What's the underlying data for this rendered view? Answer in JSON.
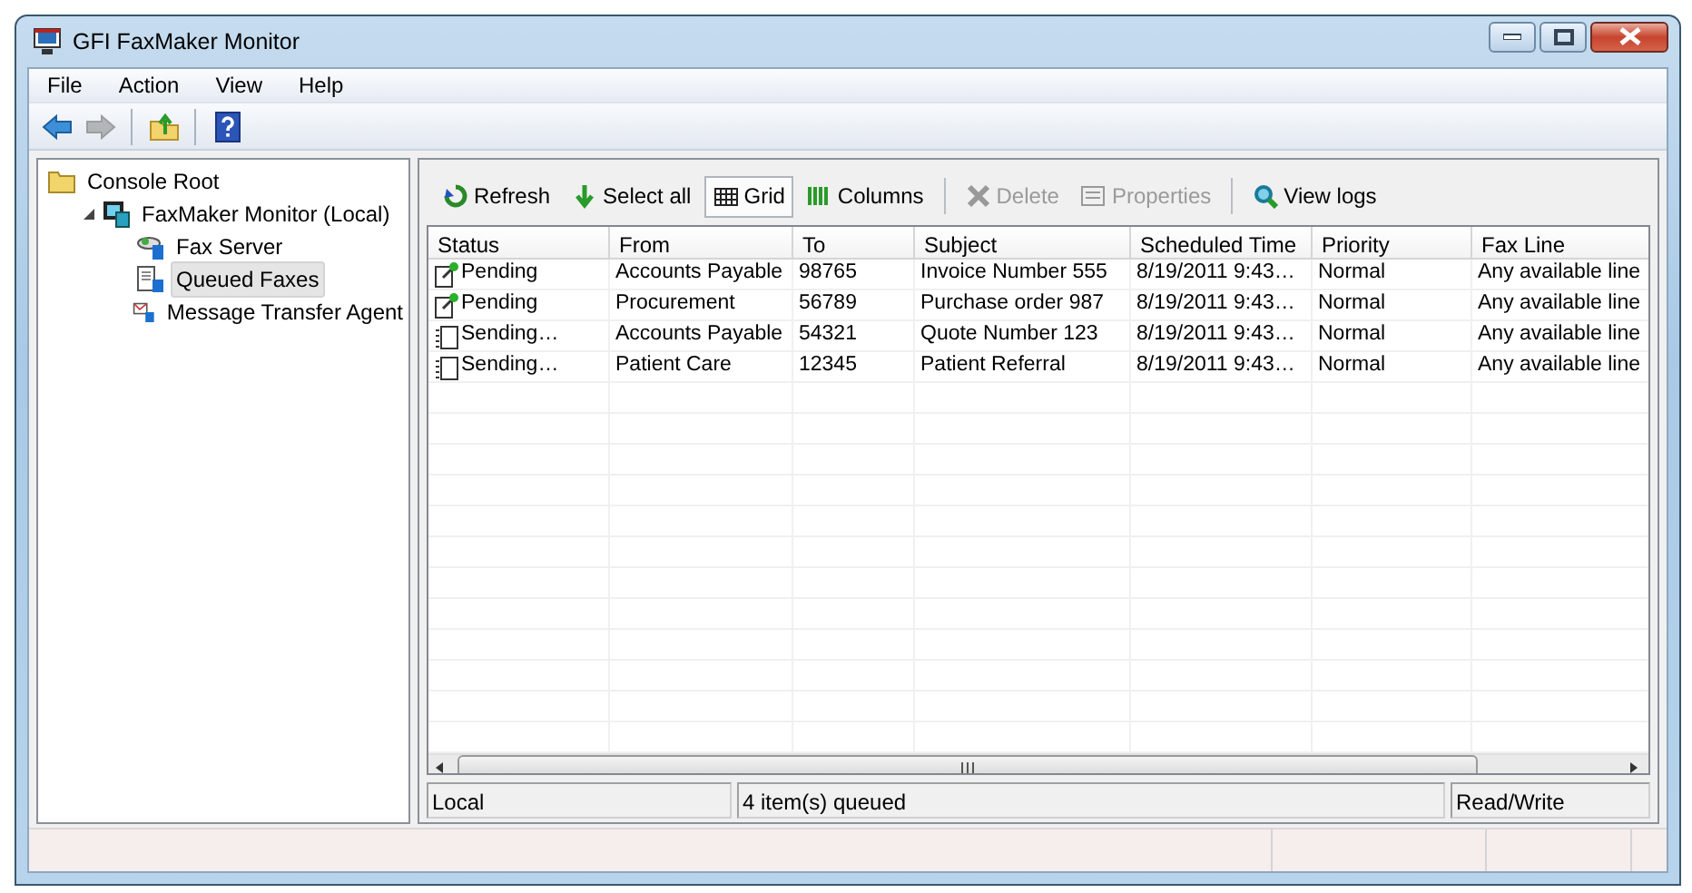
{
  "window": {
    "title": "GFI FaxMaker Monitor"
  },
  "menu": [
    "File",
    "Action",
    "View",
    "Help"
  ],
  "toolbar": [
    [
      {
        "kind": "back",
        "disabled": false
      },
      {
        "kind": "forward",
        "disabled": true
      }
    ],
    [
      {
        "kind": "up",
        "disabled": false
      }
    ],
    [
      {
        "kind": "help",
        "disabled": false
      }
    ]
  ],
  "tree": [
    {
      "label": "Console Root",
      "kind": "folder",
      "selected": false,
      "children": [
        {
          "label": "FaxMaker Monitor (Local)",
          "kind": "monitor",
          "selected": false,
          "expanded": true,
          "children": [
            {
              "label": "Fax Server",
              "kind": "server",
              "selected": false
            },
            {
              "label": "Queued Faxes",
              "kind": "queue",
              "selected": true
            },
            {
              "label": "Message Transfer Agent",
              "kind": "agent",
              "selected": false
            }
          ]
        }
      ]
    }
  ],
  "actions": [
    [
      {
        "label": "Refresh",
        "kind": "refresh",
        "disabled": false,
        "selected": false
      },
      {
        "label": "Select all",
        "kind": "select",
        "disabled": false,
        "selected": false
      },
      {
        "label": "Grid",
        "kind": "grid",
        "disabled": false,
        "selected": true
      },
      {
        "label": "Columns",
        "kind": "columns",
        "disabled": false,
        "selected": false
      }
    ],
    [
      {
        "label": "Delete",
        "kind": "delete",
        "disabled": true,
        "selected": false
      },
      {
        "label": "Properties",
        "kind": "properties",
        "disabled": true,
        "selected": false
      }
    ],
    [
      {
        "label": "View logs",
        "kind": "logs",
        "disabled": false,
        "selected": false
      }
    ]
  ],
  "table": {
    "columns": [
      "Status",
      "From",
      "To",
      "Subject",
      "Scheduled Time",
      "Priority",
      "Fax Line"
    ],
    "rows": [
      {
        "kind": "pending",
        "cells": [
          "Pending",
          "Accounts Payable",
          "98765",
          "Invoice Number 555",
          "8/19/2011 9:43…",
          "Normal",
          "Any available line"
        ]
      },
      {
        "kind": "pending",
        "cells": [
          "Pending",
          "Procurement",
          "56789",
          "Purchase order 987",
          "8/19/2011 9:43…",
          "Normal",
          "Any available line"
        ]
      },
      {
        "kind": "sending",
        "cells": [
          "Sending…",
          "Accounts Payable",
          "54321",
          "Quote Number 123",
          "8/19/2011 9:43…",
          "Normal",
          "Any available line"
        ]
      },
      {
        "kind": "sending",
        "cells": [
          "Sending…",
          "Patient Care",
          "12345",
          "Patient Referral",
          "8/19/2011 9:43…",
          "Normal",
          "Any available line"
        ]
      }
    ]
  },
  "pane_status": [
    "Local",
    "4 item(s) queued",
    "Read/Write"
  ]
}
